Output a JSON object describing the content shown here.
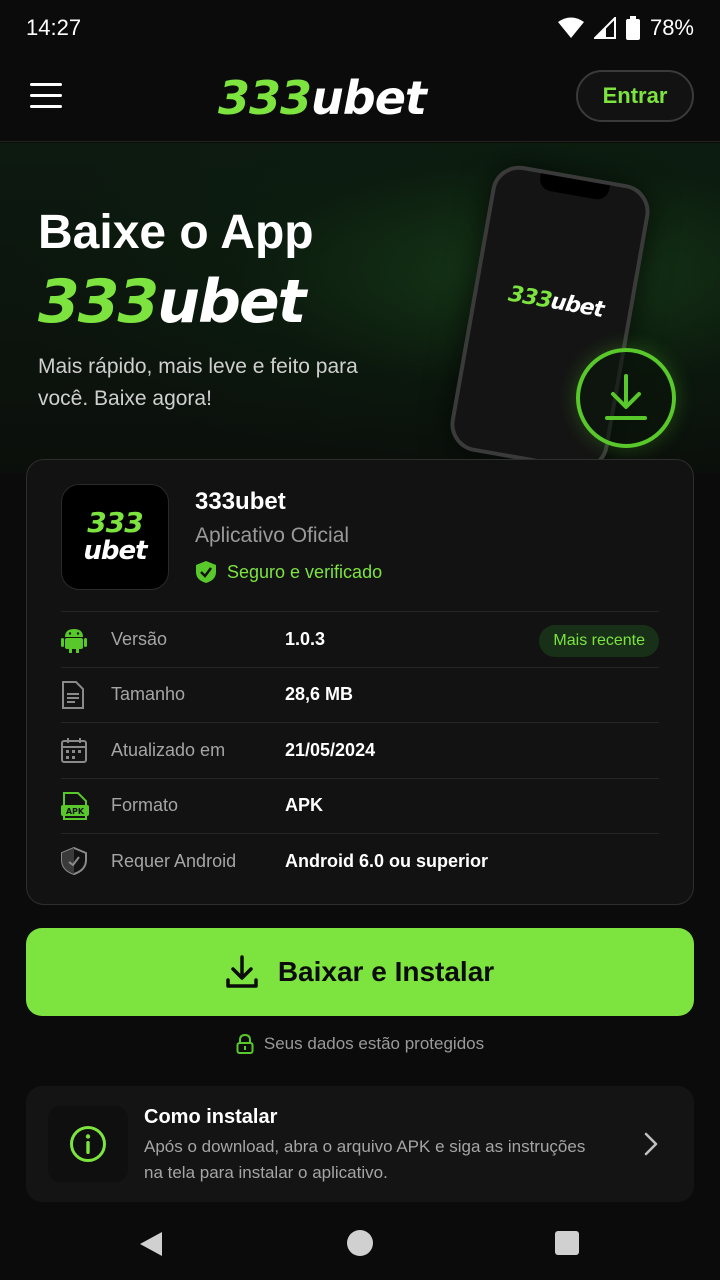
{
  "status_bar": {
    "time": "14:27",
    "battery": "78%"
  },
  "header": {
    "logo_num": "333",
    "logo_word": "ubet",
    "login_label": "Entrar"
  },
  "hero": {
    "title": "Baixe o App",
    "brand_num": "333",
    "brand_word": "ubet",
    "subtitle": "Mais rápido, mais leve e feito para você. Baixe agora!",
    "phone_logo_num": "333",
    "phone_logo_word": "ubet"
  },
  "app": {
    "icon_line1": "333",
    "icon_line2": "ubet",
    "name": "333ubet",
    "subtitle": "Aplicativo Oficial",
    "verified": "Seguro e verificado",
    "rows": [
      {
        "icon": "android-icon",
        "label": "Versão",
        "value": "1.0.3",
        "badge": "Mais recente"
      },
      {
        "icon": "file-icon",
        "label": "Tamanho",
        "value": "28,6 MB"
      },
      {
        "icon": "calendar-icon",
        "label": "Atualizado em",
        "value": "21/05/2024"
      },
      {
        "icon": "apk-icon",
        "label": "Formato",
        "value": "APK"
      },
      {
        "icon": "shield-icon",
        "label": "Requer Android",
        "value": "Android 6.0 ou superior"
      }
    ]
  },
  "download": {
    "label": "Baixar e Instalar",
    "secure_note": "Seus dados estão protegidos"
  },
  "howto": {
    "title": "Como instalar",
    "description": "Após o download, abra o arquivo APK e siga as instruções na tela para instalar o aplicativo."
  },
  "colors": {
    "accent": "#7de33f",
    "background": "#0b0b0b",
    "card": "#121212"
  }
}
